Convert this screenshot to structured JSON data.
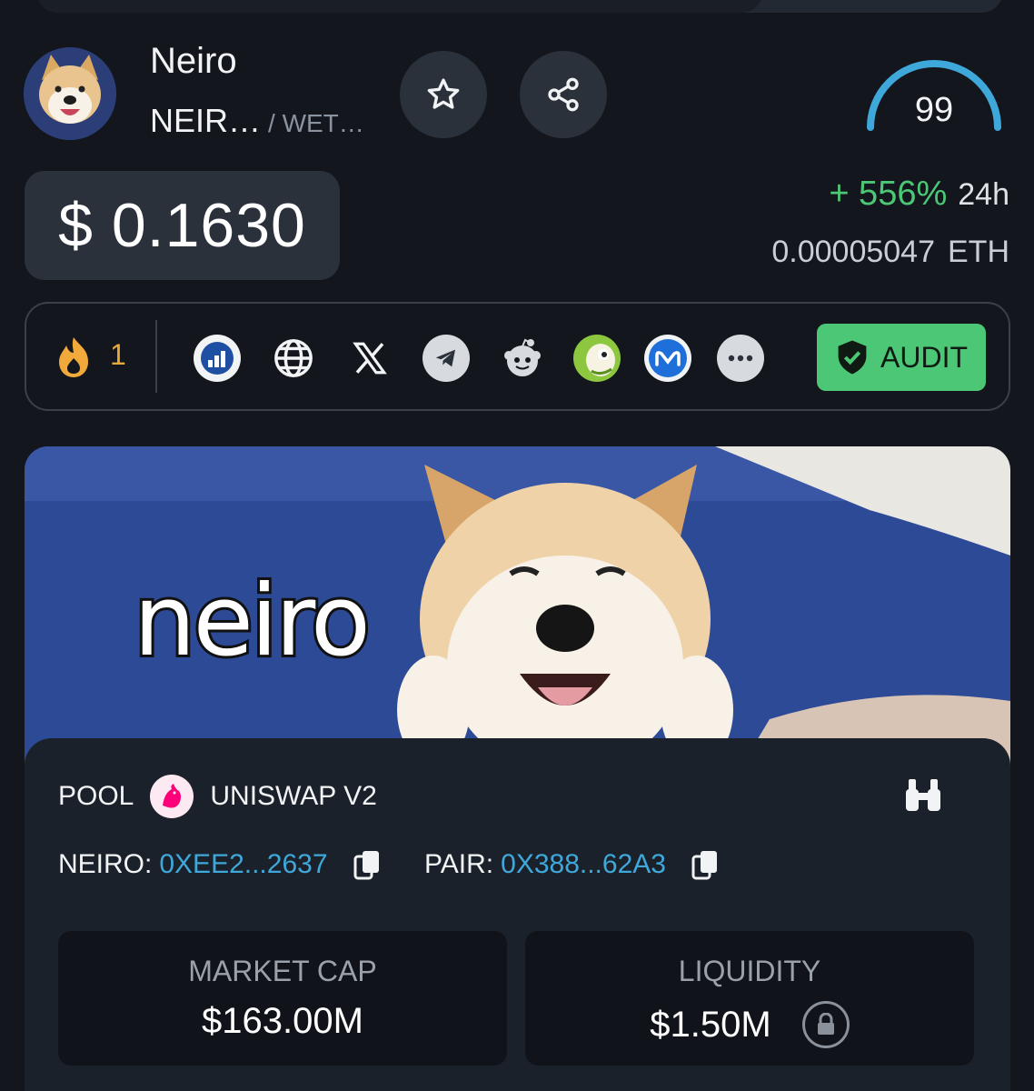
{
  "token": {
    "name": "Neiro",
    "symbol": "NEIR…",
    "quote": "/ WET…",
    "score": "99"
  },
  "price": {
    "usd": "$ 0.1630",
    "change": "+ 556%",
    "period": "24h",
    "native_value": "0.00005047",
    "native_symbol": "ETH"
  },
  "links": {
    "boost_count": "1",
    "icons": [
      "coinmarketcap-chart-icon",
      "globe-icon",
      "x-icon",
      "telegram-icon",
      "reddit-icon",
      "coingecko-icon",
      "coinmarketcap-icon",
      "more-icon"
    ],
    "audit_label": "AUDIT"
  },
  "banner": {
    "text": "neiro"
  },
  "pool": {
    "label": "POOL",
    "dex": "UNISWAP V2",
    "token_label": "NEIRO:",
    "token_address": "0XEE2...2637",
    "pair_label": "PAIR:",
    "pair_address": "0X388...62A3"
  },
  "stats": {
    "market_cap_label": "MARKET CAP",
    "market_cap_value": "$163.00M",
    "liquidity_label": "LIQUIDITY",
    "liquidity_value": "$1.50M"
  },
  "colors": {
    "background": "#13161c",
    "positive": "#4cc776",
    "link": "#3fa8db",
    "score_arc": "#3fa8db"
  }
}
